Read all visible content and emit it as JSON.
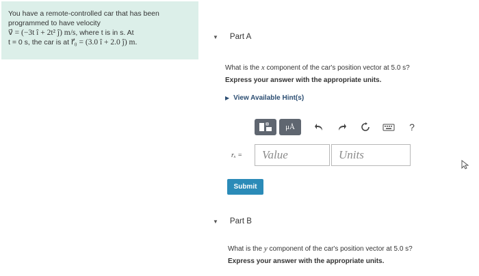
{
  "problem": {
    "line1": "You have a remote-controlled car that has been",
    "line2": "programmed to have velocity",
    "velocity_math": "v⃗ = (−3t î + 2t² ĵ) m/s",
    "line3_suffix": ", where t is in s. At",
    "line4_prefix": "t = 0 s, the car is at ",
    "position_math": "r⃗₀ = (3.0 î + 2.0 ĵ) m."
  },
  "partA": {
    "title": "Part A",
    "question_prefix": "What is the ",
    "question_var": "x",
    "question_suffix": " component of the car's position vector at 5.0 s?",
    "instruction": "Express your answer with the appropriate units.",
    "hints_label": "View Available Hint(s)",
    "answer_label": "rₓ =",
    "value_placeholder": "Value",
    "units_placeholder": "Units",
    "submit_label": "Submit"
  },
  "toolbar": {
    "mu_label": "μÅ",
    "help_label": "?"
  },
  "partB": {
    "title": "Part B",
    "question_prefix": "What is the ",
    "question_var": "y",
    "question_suffix": " component of the car's position vector at 5.0 s?",
    "instruction": "Express your answer with the appropriate units."
  },
  "colors": {
    "problem_bg": "#dcefe9",
    "submit_bg": "#2b8bb8",
    "toolbar_btn": "#5f6670",
    "hint_link": "#2b4d72"
  }
}
